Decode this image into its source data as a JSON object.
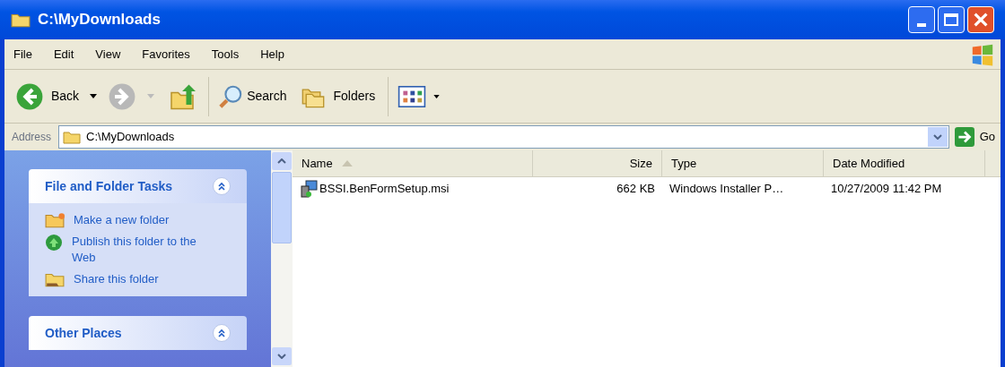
{
  "window": {
    "title": "C:\\MyDownloads"
  },
  "menu": [
    "File",
    "Edit",
    "View",
    "Favorites",
    "Tools",
    "Help"
  ],
  "toolbar": [
    {
      "kind": "back",
      "label": "Back",
      "disabled": false
    },
    {
      "kind": "forward",
      "disabled": true
    },
    {
      "kind": "up"
    },
    {
      "kind": "search",
      "label": "Search"
    },
    {
      "kind": "folders",
      "label": "Folders"
    },
    {
      "kind": "views"
    }
  ],
  "address": {
    "label": "Address",
    "value": "C:\\MyDownloads",
    "go": "Go"
  },
  "task_panels": [
    {
      "title": "File and Folder Tasks",
      "expanded": true,
      "items": [
        {
          "kind": "folder",
          "label": "Make a new folder"
        },
        {
          "kind": "globe",
          "label": "Publish this folder to the Web"
        },
        {
          "kind": "share",
          "label": "Share this folder"
        }
      ]
    },
    {
      "title": "Other Places",
      "expanded": true
    }
  ],
  "table": {
    "columns": [
      {
        "label": "Name",
        "sorted": true
      },
      {
        "label": "Size",
        "sorted": false
      },
      {
        "label": "Type",
        "sorted": false
      },
      {
        "label": "Date Modified",
        "sorted": false
      }
    ],
    "rows": [
      [
        "BSSI.BenFormSetup.msi",
        "662 KB",
        "Windows Installer P…",
        "10/27/2009 11:42 PM"
      ]
    ]
  }
}
